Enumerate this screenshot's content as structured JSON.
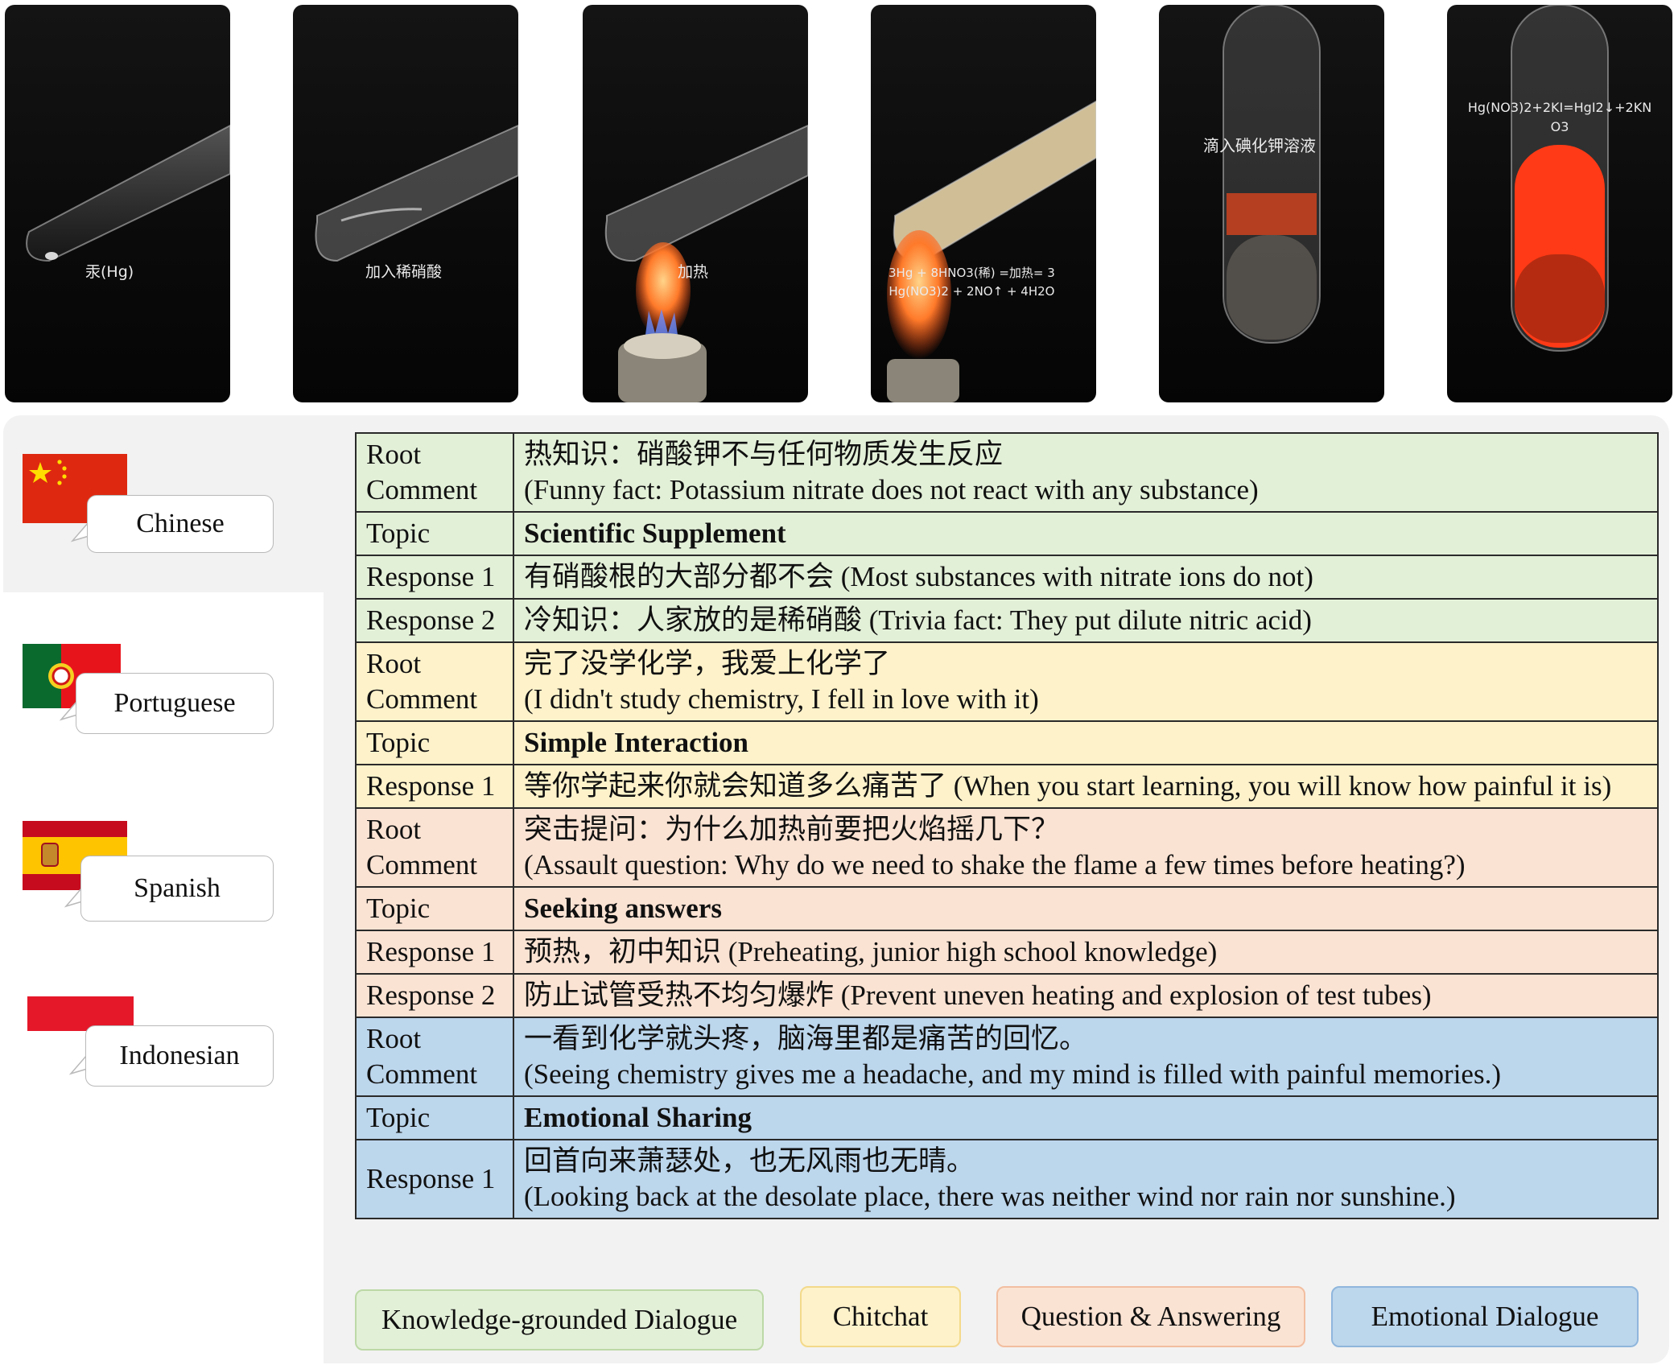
{
  "frames": [
    {
      "caption": "汞(Hg)"
    },
    {
      "caption": "加入稀硝酸"
    },
    {
      "caption": "加热"
    },
    {
      "caption": "3Hg + 8HNO3(稀) =加热= 3\nHg(NO3)2 + 2NO↑ + 4H2O"
    },
    {
      "caption": "滴入碘化钾溶液"
    },
    {
      "caption": "Hg(NO3)2+2KI=HgI2↓+2KN\nO3"
    }
  ],
  "languages": [
    {
      "name": "Chinese",
      "flag": "china-flag-icon"
    },
    {
      "name": "Portuguese",
      "flag": "portugal-flag-icon"
    },
    {
      "name": "Spanish",
      "flag": "spain-flag-icon"
    },
    {
      "name": "Indonesian",
      "flag": "indonesia-flag-icon"
    }
  ],
  "dialogue": [
    {
      "label": "Root\nComment",
      "text": "热知识：硝酸钾不与任何物质发生反应\n(Funny fact: Potassium nitrate does not react with any substance)",
      "bold": false,
      "category": "knowledge"
    },
    {
      "label": "Topic",
      "text": "Scientific Supplement",
      "bold": true,
      "category": "knowledge"
    },
    {
      "label": "Response 1",
      "text": "有硝酸根的大部分都不会 (Most substances with nitrate ions do not)",
      "bold": false,
      "category": "knowledge"
    },
    {
      "label": "Response 2",
      "text": "冷知识：人家放的是稀硝酸 (Trivia fact: They put dilute nitric acid)",
      "bold": false,
      "category": "knowledge"
    },
    {
      "label": "Root\nComment",
      "text": "完了没学化学，我爱上化学了\n(I didn't study chemistry, I fell in love with it)",
      "bold": false,
      "category": "chitchat"
    },
    {
      "label": "Topic",
      "text": "Simple Interaction",
      "bold": true,
      "category": "chitchat"
    },
    {
      "label": "Response 1",
      "text": "等你学起来你就会知道多么痛苦了 (When you start learning, you will know how painful it is)",
      "bold": false,
      "category": "chitchat"
    },
    {
      "label": "Root\nComment",
      "text": "突击提问：为什么加热前要把火焰摇几下？\n(Assault question: Why do we need to shake the flame a few times before heating?)",
      "bold": false,
      "category": "qa"
    },
    {
      "label": "Topic",
      "text": "Seeking answers",
      "bold": true,
      "category": "qa"
    },
    {
      "label": "Response 1",
      "text": "预热，初中知识 (Preheating, junior high school knowledge)",
      "bold": false,
      "category": "qa"
    },
    {
      "label": "Response 2",
      "text": "防止试管受热不均匀爆炸 (Prevent uneven heating and explosion of test tubes)",
      "bold": false,
      "category": "qa"
    },
    {
      "label": "Root\nComment",
      "text": "一看到化学就头疼，脑海里都是痛苦的回忆。\n(Seeing chemistry gives me a headache, and my mind is filled with painful memories.)",
      "bold": false,
      "category": "emotional"
    },
    {
      "label": "Topic",
      "text": "Emotional Sharing",
      "bold": true,
      "category": "emotional"
    },
    {
      "label": "Response 1",
      "text": "回首向来萧瑟处，也无风雨也无晴。\n(Looking back at the desolate place, there was neither wind nor rain nor sunshine.)",
      "bold": false,
      "category": "emotional"
    }
  ],
  "legend": [
    {
      "label": "Knowledge-grounded Dialogue",
      "bg": "#e3f0d8",
      "border": "#bcd9a6"
    },
    {
      "label": "Chitchat",
      "bg": "#fdf2ca",
      "border": "#f3d98a"
    },
    {
      "label": "Question & Answering",
      "bg": "#fbe3d3",
      "border": "#f2bea0"
    },
    {
      "label": "Emotional Dialogue",
      "bg": "#bcd6ec",
      "border": "#8fb6dc"
    }
  ],
  "colors": {
    "knowledge": "#e3f0d8",
    "chitchat": "#fdf2ca",
    "qa": "#fbe3d3",
    "emotional": "#bcd6ec"
  }
}
